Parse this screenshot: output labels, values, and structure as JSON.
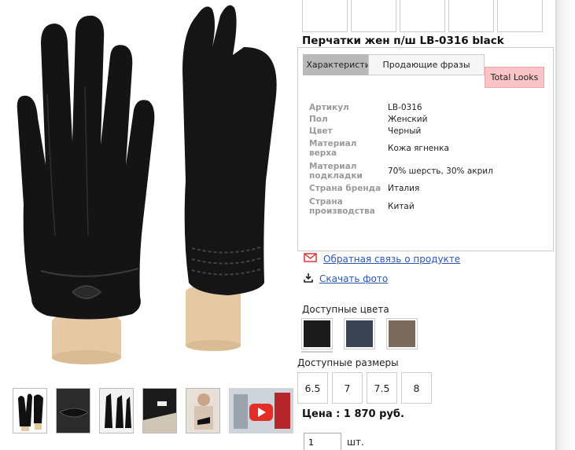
{
  "product": {
    "title": "Перчатки жен п/ш LB-0316 black",
    "price": "Цена : 1 870 руб."
  },
  "tabs": {
    "specs": "Характеристики",
    "phrases": "Продающие фразы",
    "looks": "Total Looks"
  },
  "specs": [
    {
      "label": "Артикул",
      "value": "LB-0316"
    },
    {
      "label": "Пол",
      "value": "Женский"
    },
    {
      "label": "Цвет",
      "value": "Черный"
    },
    {
      "label": "Материал верха",
      "value": "Кожа ягненка"
    },
    {
      "label": "Материал подкладки",
      "value": "70% шерсть, 30% акрил"
    },
    {
      "label": "Страна бренда",
      "value": "Италия"
    },
    {
      "label": "Страна производства",
      "value": "Китай"
    }
  ],
  "links": {
    "feedback": "Обратная связь о продукте",
    "download": "Скачать фото"
  },
  "colors": {
    "label": "Доступные цвета",
    "swatches": [
      {
        "name": "black",
        "hex": "#1b1b1b"
      },
      {
        "name": "navy",
        "hex": "#3a4453"
      },
      {
        "name": "taupe",
        "hex": "#7c6b5c"
      }
    ]
  },
  "sizes": {
    "label": "Доступные размеры",
    "options": [
      "6.5",
      "7",
      "7.5",
      "8"
    ]
  },
  "quantity": {
    "value": "1",
    "unit": "шт."
  },
  "icons": {
    "feedback": "envelope-icon",
    "download": "download-icon",
    "video": "play-icon"
  },
  "accent": {
    "link": "#2a57b5",
    "total_looks_bg": "#f9c4c7",
    "video_play": "#e52d27"
  }
}
